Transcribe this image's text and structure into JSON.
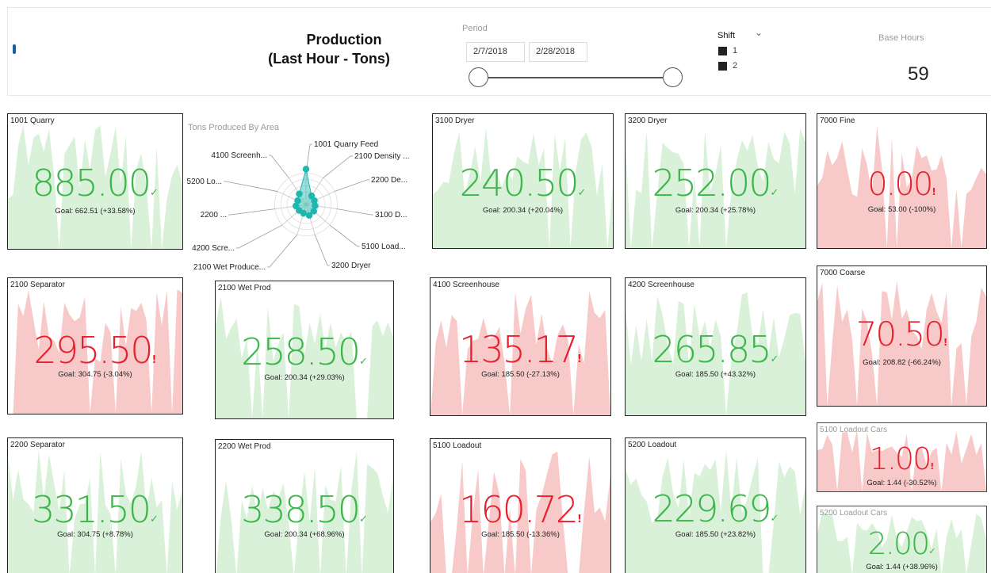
{
  "header": {
    "title_line1": "Production",
    "title_line2": "(Last Hour - Tons)",
    "period_label": "Period",
    "date_start": "2/7/2018",
    "date_end": "2/28/2018",
    "shift_label": "Shift",
    "shift_options": [
      "1",
      "2"
    ],
    "base_hours_label": "Base Hours",
    "base_hours_value": "59"
  },
  "colors": {
    "good": "#3cb54a",
    "good_fill": "#d9f0d9",
    "bad": "#e8202d",
    "bad_fill": "#f8c9c9",
    "radar": "#1db7b0"
  },
  "radar": {
    "title": "Tons Produced By Area",
    "labels": [
      "1001 Quarry Feed",
      "2100 Density ...",
      "2200 De...",
      "3100 D...",
      "5100 Load...",
      "3200 Dryer",
      "2100 Wet Produce...",
      "4200 Scre...",
      "2200 ...",
      "5200 Lo...",
      "4100 Screenh..."
    ]
  },
  "tiles": {
    "t1001": {
      "name": "1001 Quarry",
      "value": "885.00",
      "goal": "Goal: 662.51 (+33.58%)",
      "status": "good",
      "mark": "✓"
    },
    "t3100": {
      "name": "3100 Dryer",
      "value": "240.50",
      "goal": "Goal: 200.34 (+20.04%)",
      "status": "good",
      "mark": "✓"
    },
    "t3200": {
      "name": "3200 Dryer",
      "value": "252.00",
      "goal": "Goal: 200.34 (+25.78%)",
      "status": "good",
      "mark": "✓"
    },
    "t7000f": {
      "name": "7000 Fine",
      "value": "0.00",
      "goal": "Goal: 53.00 (-100%)",
      "status": "bad",
      "mark": "!"
    },
    "t2100s": {
      "name": "2100 Separator",
      "value": "295.50",
      "goal": "Goal: 304.75 (-3.04%)",
      "status": "bad",
      "mark": "!"
    },
    "t2100w": {
      "name": "2100 Wet Prod",
      "value": "258.50",
      "goal": "Goal: 200.34 (+29.03%)",
      "status": "good",
      "mark": "✓"
    },
    "t4100": {
      "name": "4100 Screenhouse",
      "value": "135.17",
      "goal": "Goal: 185.50 (-27.13%)",
      "status": "bad",
      "mark": "!"
    },
    "t4200": {
      "name": "4200 Screenhouse",
      "value": "265.85",
      "goal": "Goal: 185.50 (+43.32%)",
      "status": "good",
      "mark": "✓"
    },
    "t7000c": {
      "name": "7000 Coarse",
      "value": "70.50",
      "goal": "Goal: 208.82 (-66.24%)",
      "status": "bad",
      "mark": "!"
    },
    "t2200s": {
      "name": "2200 Separator",
      "value": "331.50",
      "goal": "Goal: 304.75 (+8.78%)",
      "status": "good",
      "mark": "✓"
    },
    "t2200w": {
      "name": "2200 Wet Prod",
      "value": "338.50",
      "goal": "Goal: 200.34 (+68.96%)",
      "status": "good",
      "mark": "✓"
    },
    "t5100": {
      "name": "5100 Loadout",
      "value": "160.72",
      "goal": "Goal: 185.50 (-13.36%)",
      "status": "bad",
      "mark": "!"
    },
    "t5200": {
      "name": "5200 Loadout",
      "value": "229.69",
      "goal": "Goal: 185.50 (+23.82%)",
      "status": "good",
      "mark": "✓"
    },
    "t5100c": {
      "name": "5100 Loadout Cars",
      "value": "1.00",
      "goal": "Goal: 1.44 (-30.52%)",
      "status": "bad",
      "mark": "!"
    },
    "t5200c": {
      "name": "5200 Loadout Cars",
      "value": "2.00",
      "goal": "Goal: 1.44 (+38.96%)",
      "status": "good",
      "mark": "✓"
    }
  }
}
